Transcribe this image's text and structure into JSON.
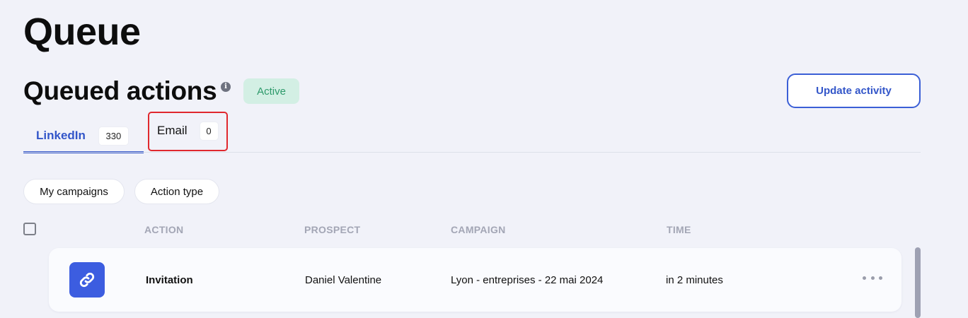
{
  "page": {
    "title": "Queue"
  },
  "section": {
    "title": "Queued actions",
    "info_icon": "info-icon",
    "status": "Active",
    "update_button": "Update activity"
  },
  "tabs": [
    {
      "label": "LinkedIn",
      "count": "330",
      "active": true
    },
    {
      "label": "Email",
      "count": "0",
      "active": false,
      "highlighted": true
    }
  ],
  "filters": [
    "My campaigns",
    "Action type"
  ],
  "table": {
    "columns": [
      "ACTION",
      "PROSPECT",
      "CAMPAIGN",
      "TIME"
    ],
    "rows": [
      {
        "icon": "link-icon",
        "action": "Invitation",
        "prospect": "Daniel Valentine",
        "campaign": "Lyon - entreprises - 22 mai 2024",
        "time": "in 2 minutes"
      }
    ]
  },
  "colors": {
    "accent": "#3356c9",
    "status_bg": "#d3efe4",
    "status_text": "#2e9a6b",
    "highlight": "#e0282e",
    "icon_bg": "#3c5de0"
  }
}
